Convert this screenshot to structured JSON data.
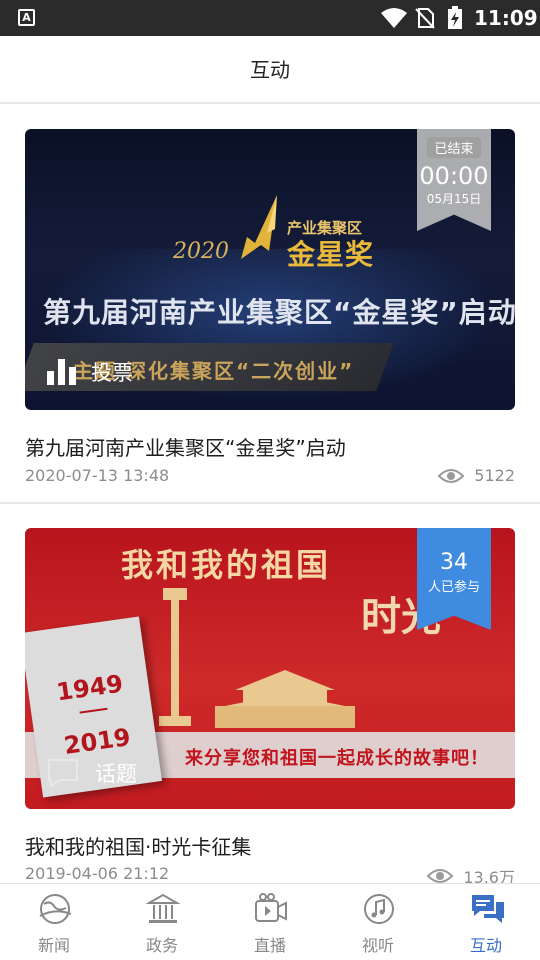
{
  "status_bar": {
    "time": "11:09",
    "left_icon_letter": "A"
  },
  "header": {
    "title": "互动"
  },
  "cards": [
    {
      "title": "第九届河南产业集聚区“金星奖”启动",
      "date": "2020-07-13 13:48",
      "views": "5122",
      "badge_label": "投票",
      "status": {
        "state": "已结束",
        "countdown": "00:00",
        "date": "05月15日"
      },
      "image_text": {
        "logo_year": "2020",
        "logo_top": "产业集聚区",
        "logo_main": "金星奖",
        "headline": "第九届河南产业集聚区“金星奖”启动",
        "band": "主题 深化集聚区“二次创业”"
      }
    },
    {
      "title": "我和我的祖国·时光卡征集",
      "date": "2019-04-06 21:12",
      "views": "13.6万",
      "badge_label": "话题",
      "participants": {
        "count": "34",
        "label": "人已参与"
      },
      "image_text": {
        "heading": "我和我的祖国",
        "shi": "时光",
        "year1": "1949",
        "year2": "2019",
        "strip": "来分享您和祖国一起成长的故事吧！"
      }
    }
  ],
  "nav": {
    "items": [
      {
        "label": "新闻",
        "icon": "globe-icon"
      },
      {
        "label": "政务",
        "icon": "government-building-icon"
      },
      {
        "label": "直播",
        "icon": "video-camera-icon"
      },
      {
        "label": "视听",
        "icon": "music-note-icon"
      },
      {
        "label": "互动",
        "icon": "chat-bubbles-icon"
      }
    ],
    "active": "互动",
    "active_color": "#3a6fc4"
  }
}
